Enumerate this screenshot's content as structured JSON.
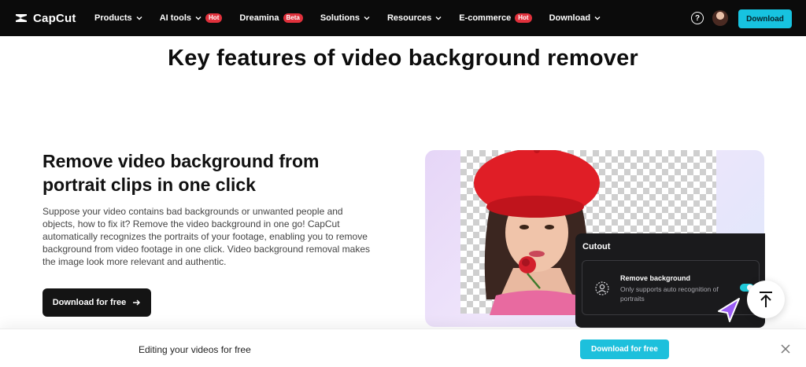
{
  "nav": {
    "logo_text": "CapCut",
    "items": [
      {
        "label": "Products",
        "has_dropdown": true,
        "badge": ""
      },
      {
        "label": "AI tools",
        "has_dropdown": true,
        "badge": "Hot"
      },
      {
        "label": "Dreamina",
        "has_dropdown": false,
        "badge": "Beta"
      },
      {
        "label": "Solutions",
        "has_dropdown": true,
        "badge": ""
      },
      {
        "label": "Resources",
        "has_dropdown": true,
        "badge": ""
      },
      {
        "label": "E-commerce",
        "has_dropdown": false,
        "badge": "Hot"
      },
      {
        "label": "Download",
        "has_dropdown": true,
        "badge": ""
      }
    ],
    "help_glyph": "?",
    "download_label": "Download"
  },
  "page_title": "Key features of video background remover",
  "feature": {
    "heading": "Remove video background from portrait clips in one click",
    "body": "Suppose your video contains bad backgrounds or unwanted people and objects, how to fix it? Remove the video background in one go! CapCut automatically recognizes the portraits of your footage, enabling you to remove background from video footage in one click. Video background removal makes the image look more relevant and authentic.",
    "cta_label": "Download for free"
  },
  "cutout_panel": {
    "title": "Cutout",
    "option_title": "Remove background",
    "option_desc": "Only supports auto recognition of portraits",
    "toggle_on": true
  },
  "bottom_bar": {
    "text": "Editing your videos for free",
    "button_label": "Download for free"
  },
  "colors": {
    "accent": "#17c3e0",
    "nav_bg": "#0b0b0b",
    "badge": "#e0313c",
    "cta_dark": "#141414"
  }
}
